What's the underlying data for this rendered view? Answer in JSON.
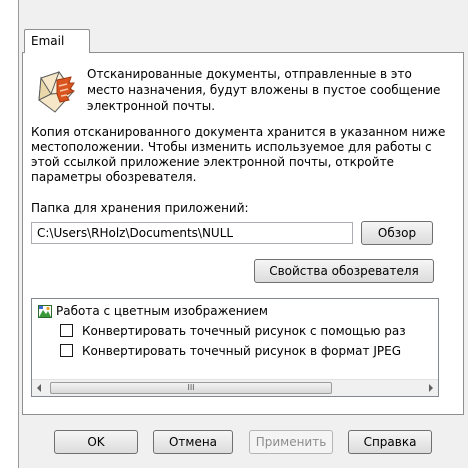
{
  "tab": {
    "label": "Email"
  },
  "intro_text": "Отсканированные документы, отправленные в это место назначения, будут вложены в пустое сообщение электронной почты.",
  "description": "Копия отсканированного документа хранится в указанном ниже местоположении. Чтобы изменить используемое для работы с этой ссылкой приложение электронной почты, откройте параметры обозревателя.",
  "folder": {
    "label": "Папка для хранения приложений:",
    "value": "C:\\Users\\RHolz\\Documents\\NULL",
    "browse_label": "Обзор"
  },
  "browser_props_label": "Свойства обозревателя",
  "tree": {
    "root_label": "Работа с цветным изображением",
    "items": [
      {
        "label": "Конвертировать точечный рисунок с помощью раз",
        "checked": false
      },
      {
        "label": "Конвертировать точечный рисунок в формат JPEG",
        "checked": false
      }
    ],
    "scroll_grip": "III"
  },
  "buttons": {
    "ok": "OK",
    "cancel": "Отмена",
    "apply": "Применить",
    "help": "Справка"
  }
}
